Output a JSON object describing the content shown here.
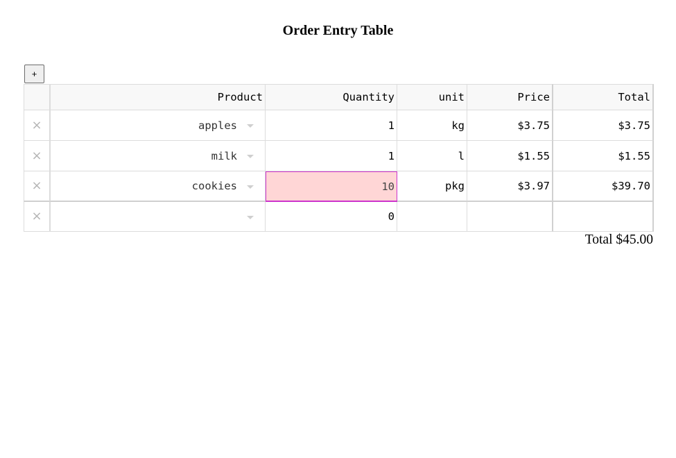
{
  "page": {
    "title": "Order Entry Table"
  },
  "toolbar": {
    "add_label": "+"
  },
  "table": {
    "columns": [
      "Product",
      "Quantity",
      "unit",
      "Price",
      "Total"
    ],
    "delete_glyph": "×",
    "rows": [
      {
        "product": "apples",
        "quantity": "1",
        "unit": "kg",
        "price": "$3.75",
        "total": "$3.75"
      },
      {
        "product": "milk",
        "quantity": "1",
        "unit": "l",
        "price": "$1.55",
        "total": "$1.55"
      },
      {
        "product": "cookies",
        "quantity": "10",
        "unit": "pkg",
        "price": "$3.97",
        "total": "$39.70"
      },
      {
        "product": "",
        "quantity": "0",
        "unit": "",
        "price": "",
        "total": ""
      }
    ]
  },
  "summary": {
    "total_text": "Total $45.00"
  },
  "colors": {
    "invalid_cell_background": "#ffd6d6",
    "invalid_cell_border": "#cc33cc",
    "header_background": "#f8f8f8"
  },
  "icons": {
    "delete": "close-icon",
    "dropdown": "chevron-down-icon"
  }
}
